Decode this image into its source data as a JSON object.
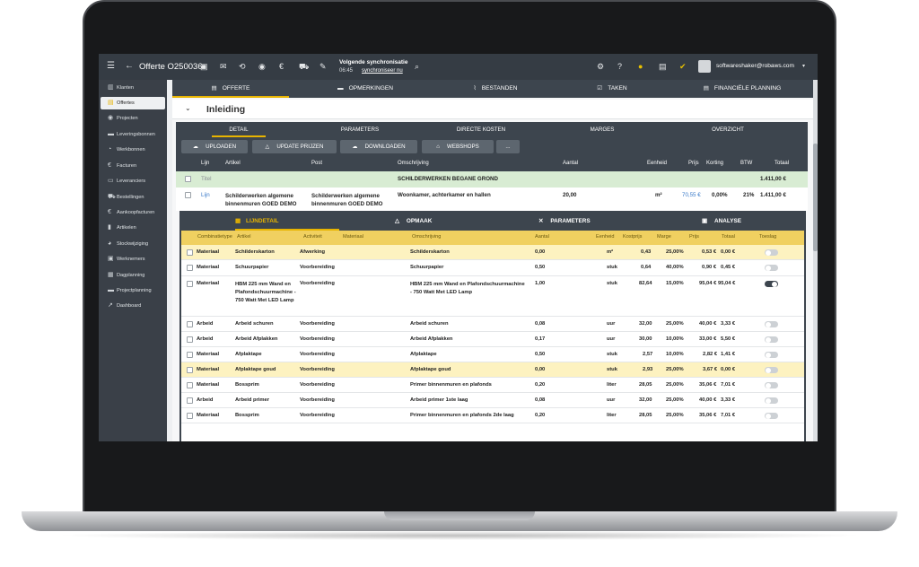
{
  "topbar": {
    "title": "Offerte O250036",
    "sync_label": "Volgende synchronisatie",
    "sync_time": "06:45",
    "sync_link": "synchroniseer nu",
    "user_email": "softwareshaker@robaws.com"
  },
  "sidebar": {
    "items": [
      {
        "label": "Klanten",
        "icon": "building-icon"
      },
      {
        "label": "Offertes",
        "icon": "document-icon",
        "active": true
      },
      {
        "label": "Projecten",
        "icon": "target-icon"
      },
      {
        "label": "Leveringsbonnen",
        "icon": "truck-icon"
      },
      {
        "label": "Werkbonnen",
        "icon": "clock-icon"
      },
      {
        "label": "Facturen",
        "icon": "euro-icon"
      },
      {
        "label": "Leveranciers",
        "icon": "id-card-icon"
      },
      {
        "label": "Bestellingen",
        "icon": "cart-icon"
      },
      {
        "label": "Aankoopfacturen",
        "icon": "euro-icon"
      },
      {
        "label": "Artikelen",
        "icon": "book-icon"
      },
      {
        "label": "Stockwijziging",
        "icon": "chart-icon"
      },
      {
        "label": "Werknemers",
        "icon": "person-icon"
      },
      {
        "label": "Dagplanning",
        "icon": "grid-icon"
      },
      {
        "label": "Projectplanning",
        "icon": "bars-icon"
      },
      {
        "label": "Dashboard",
        "icon": "trend-icon"
      }
    ]
  },
  "tabs": [
    {
      "label": "OFFERTE",
      "icon": "document-icon",
      "active": true
    },
    {
      "label": "OPMERKINGEN",
      "icon": "comment-icon"
    },
    {
      "label": "BESTANDEN",
      "icon": "paperclip-icon"
    },
    {
      "label": "TAKEN",
      "icon": "checkbox-icon"
    },
    {
      "label": "FINANCIËLE PLANNING",
      "icon": "document-icon"
    }
  ],
  "section": {
    "title": "Inleiding"
  },
  "subtabs": [
    "DETAIL",
    "PARAMETERS",
    "DIRECTE KOSTEN",
    "MARGES",
    "OVERZICHT"
  ],
  "buttons": [
    "UPLOADEN",
    "UPDATE PRIJZEN",
    "DOWNLOADEN",
    "WEBSHOPS",
    "..."
  ],
  "columns": {
    "lijn": "Lijn",
    "artikel": "Artikel",
    "post": "Post",
    "omschrijving": "Omschrijving",
    "aantal": "Aantal",
    "eenheid": "Eenheid",
    "prijs": "Prijs",
    "korting": "Korting",
    "btw": "BTW",
    "totaal": "Totaal"
  },
  "title_row": {
    "type": "Titel",
    "description": "SCHILDERWERKEN BEGANE GROND",
    "total": "1.411,00 €"
  },
  "line_row": {
    "type": "Lijn",
    "article": "Schilderwerken algemene binnenmuren GOED DEMO",
    "post": "Schilderwerken algemene binnenmuren GOED DEMO",
    "description": "Woonkamer, achterkamer en hallen",
    "quantity": "20,00",
    "unit": "m²",
    "price": "70,55 €",
    "discount": "0,00%",
    "vat": "21%",
    "total": "1.411,00 €"
  },
  "detail_tabs": [
    {
      "label": "LIJNDETAIL",
      "icon": "grid-icon",
      "active": true
    },
    {
      "label": "OPMAAK",
      "icon": "triangle-icon"
    },
    {
      "label": "PARAMETERS",
      "icon": "wrench-icon"
    },
    {
      "label": "ANALYSE",
      "icon": "chart-icon"
    }
  ],
  "detail_columns": {
    "type": "Combinatietype",
    "artikel": "Artikel",
    "activiteit": "Activiteit",
    "materiaal": "Materiaal",
    "omschrijving": "Omschrijving",
    "aantal": "Aantal",
    "eenheid": "Eenheid",
    "kostprijs": "Kostprijs",
    "marge": "Marge",
    "prijs": "Prijs",
    "totaal": "Totaal",
    "toeslag": "Toeslag"
  },
  "detail_rows": [
    {
      "type": "Materiaal",
      "article": "Schilderskarton",
      "activity": "Afwerking",
      "description": "Schilderskarton",
      "quantity": "0,00",
      "unit": "m²",
      "cost": "0,43",
      "margin": "25,00%",
      "price": "0,53 €",
      "total": "0,00 €",
      "toggle": false,
      "highlight": true
    },
    {
      "type": "Materiaal",
      "article": "Schuurpapier",
      "activity": "Voorbereiding",
      "description": "Schuurpapier",
      "quantity": "0,50",
      "unit": "stuk",
      "cost": "0,64",
      "margin": "40,00%",
      "price": "0,90 €",
      "total": "0,45 €",
      "toggle": false,
      "highlight": false
    },
    {
      "type": "Materiaal",
      "article": "HBM 225 mm Wand en Plafondschuurmachine - 750 Watt Met LED Lamp",
      "activity": "Voorbereiding",
      "description": "HBM 225 mm Wand en Plafondschuurmachine - 750 Watt Met LED Lamp",
      "quantity": "1,00",
      "unit": "stuk",
      "cost": "82,64",
      "margin": "15,00%",
      "price": "95,04 €",
      "total": "95,04 €",
      "toggle": true,
      "highlight": false
    },
    {
      "type": "Arbeid",
      "article": "Arbeid schuren",
      "activity": "Voorbereiding",
      "description": "Arbeid schuren",
      "quantity": "0,08",
      "unit": "uur",
      "cost": "32,00",
      "margin": "25,00%",
      "price": "40,00 €",
      "total": "3,33 €",
      "toggle": false,
      "highlight": false
    },
    {
      "type": "Arbeid",
      "article": "Arbeid Afplakken",
      "activity": "Voorbereiding",
      "description": "Arbeid Afplakken",
      "quantity": "0,17",
      "unit": "uur",
      "cost": "30,00",
      "margin": "10,00%",
      "price": "33,00 €",
      "total": "5,50 €",
      "toggle": false,
      "highlight": false
    },
    {
      "type": "Materiaal",
      "article": "Afplaktape",
      "activity": "Voorbereiding",
      "description": "Afplaktape",
      "quantity": "0,50",
      "unit": "stuk",
      "cost": "2,57",
      "margin": "10,00%",
      "price": "2,82 €",
      "total": "1,41 €",
      "toggle": false,
      "highlight": false
    },
    {
      "type": "Materiaal",
      "article": "Afplaktape goud",
      "activity": "Voorbereiding",
      "description": "Afplaktape goud",
      "quantity": "0,00",
      "unit": "stuk",
      "cost": "2,93",
      "margin": "25,00%",
      "price": "3,67 €",
      "total": "0,00 €",
      "toggle": false,
      "highlight": true
    },
    {
      "type": "Materiaal",
      "article": "Bossprim",
      "activity": "Voorbereiding",
      "description": "Primer binnenmuren en plafonds",
      "quantity": "0,20",
      "unit": "liter",
      "cost": "28,05",
      "margin": "25,00%",
      "price": "35,06 €",
      "total": "7,01 €",
      "toggle": false,
      "highlight": false
    },
    {
      "type": "Arbeid",
      "article": "Arbeid primer",
      "activity": "Voorbereiding",
      "description": "Arbeid primer 1ste laag",
      "quantity": "0,08",
      "unit": "uur",
      "cost": "32,00",
      "margin": "25,00%",
      "price": "40,00 €",
      "total": "3,33 €",
      "toggle": false,
      "highlight": false
    },
    {
      "type": "Materiaal",
      "article": "Bossprim",
      "activity": "Voorbereiding",
      "description": "Primer binnenmuren en plafonds 2de laag",
      "quantity": "0,20",
      "unit": "liter",
      "cost": "28,05",
      "margin": "25,00%",
      "price": "35,06 €",
      "total": "7,01 €",
      "toggle": false,
      "highlight": false
    }
  ]
}
